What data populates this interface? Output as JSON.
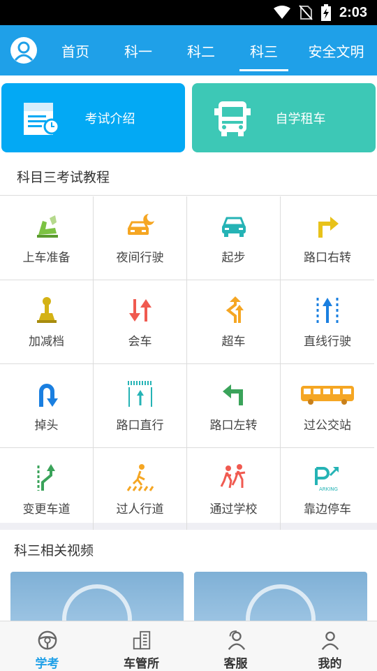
{
  "status_bar": {
    "time": "2:03"
  },
  "top_nav": {
    "tabs": [
      {
        "label": "首页"
      },
      {
        "label": "科一"
      },
      {
        "label": "科二"
      },
      {
        "label": "科三",
        "active": true
      },
      {
        "label": "安全文明"
      }
    ],
    "background": "#1fa0e8"
  },
  "cards": [
    {
      "label": "考试介绍",
      "icon": "exam-intro-icon",
      "color": "#03a9f4"
    },
    {
      "label": "自学租车",
      "icon": "bus-rental-icon",
      "color": "#3dc8b6"
    }
  ],
  "tutorial": {
    "title": "科目三考试教程",
    "items": [
      {
        "label": "上车准备",
        "icon": "seat-icon"
      },
      {
        "label": "夜间行驶",
        "icon": "night-car-icon"
      },
      {
        "label": "起步",
        "icon": "car-start-icon"
      },
      {
        "label": "路口右转",
        "icon": "turn-right-icon"
      },
      {
        "label": "加减档",
        "icon": "gear-shift-icon"
      },
      {
        "label": "会车",
        "icon": "meeting-cars-icon"
      },
      {
        "label": "超车",
        "icon": "overtake-icon"
      },
      {
        "label": "直线行驶",
        "icon": "straight-lane-icon"
      },
      {
        "label": "掉头",
        "icon": "u-turn-icon"
      },
      {
        "label": "路口直行",
        "icon": "intersection-straight-icon"
      },
      {
        "label": "路口左转",
        "icon": "turn-left-icon"
      },
      {
        "label": "过公交站",
        "icon": "bus-stop-icon"
      },
      {
        "label": "变更车道",
        "icon": "lane-change-icon"
      },
      {
        "label": "过人行道",
        "icon": "crosswalk-icon"
      },
      {
        "label": "通过学校",
        "icon": "school-icon"
      },
      {
        "label": "靠边停车",
        "icon": "parking-icon"
      }
    ]
  },
  "videos": {
    "title": "科三相关视频"
  },
  "bottom_nav": [
    {
      "label": "学考",
      "icon": "steering-wheel-icon",
      "active": true
    },
    {
      "label": "车管所",
      "icon": "building-icon"
    },
    {
      "label": "客服",
      "icon": "customer-service-icon"
    },
    {
      "label": "我的",
      "icon": "user-icon"
    }
  ],
  "colors": {
    "accent": "#1fa0e8",
    "orange": "#f5a623",
    "green": "#4caf50",
    "red": "#f05a50",
    "teal": "#25b3b5"
  }
}
